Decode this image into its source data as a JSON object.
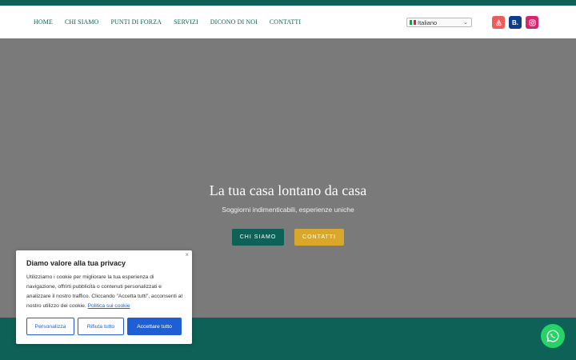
{
  "nav": {
    "items": [
      "HOME",
      "CHI SIAMO",
      "PUNTI DI FORZA",
      "SERVIZI",
      "DICONO DI NOI",
      "CONTATTI"
    ]
  },
  "language": {
    "selected": "Italiano"
  },
  "social": {
    "booking_letter": "B."
  },
  "hero": {
    "title": "La tua casa lontano da casa",
    "subtitle": "Soggiorni indimenticabili, esperienze uniche",
    "primary_button": "CHI SIAMO",
    "secondary_button": "CONTATTI"
  },
  "cookie": {
    "title": "Diamo valore alla tua privacy",
    "body": "Utilizziamo i cookie per migliorare la tua esperienza di navigazione, offrirti pubblicità o contenuti personalizzati e analizzare il nostro traffico. Cliccando \"Accetta tutti\", acconsenti al nostro utilizzo dei cookie.",
    "policy_link": "Politica sui cookie",
    "close": "×",
    "buttons": {
      "customize": "Personalizza",
      "reject": "Rifiuta tutto",
      "accept": "Accettare tutto"
    }
  },
  "colors": {
    "brand": "#0e6157",
    "accent": "#d9a82a",
    "cookie_blue": "#1e5fd6",
    "whatsapp": "#25d366"
  },
  "icons": {
    "airbnb": "airbnb-icon",
    "booking": "booking-icon",
    "instagram": "instagram-icon",
    "whatsapp": "whatsapp-icon",
    "close": "close-icon",
    "flag": "italy-flag-icon"
  }
}
